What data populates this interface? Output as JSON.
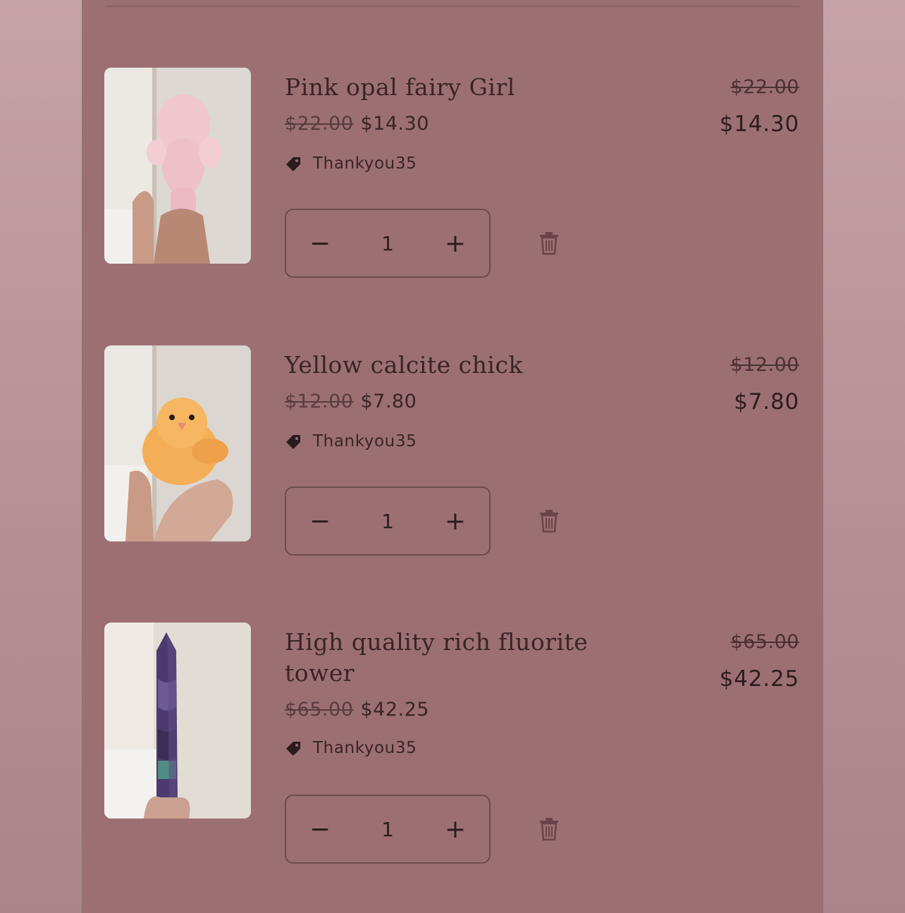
{
  "cart": {
    "items": [
      {
        "title": "Pink opal fairy Girl",
        "compare_price": "$22.00",
        "sale_price": "$14.30",
        "discount_code": "Thankyou35",
        "quantity": "1",
        "line_compare_price": "$22.00",
        "line_total": "$14.30",
        "image": "pink-opal-fairy-figurine"
      },
      {
        "title": "Yellow calcite chick",
        "compare_price": "$12.00",
        "sale_price": "$7.80",
        "discount_code": "Thankyou35",
        "quantity": "1",
        "line_compare_price": "$12.00",
        "line_total": "$7.80",
        "image": "yellow-calcite-chick-figurine"
      },
      {
        "title": "High quality rich fluorite tower",
        "compare_price": "$65.00",
        "sale_price": "$42.25",
        "discount_code": "Thankyou35",
        "quantity": "1",
        "line_compare_price": "$65.00",
        "line_total": "$42.25",
        "image": "fluorite-tower-crystal"
      }
    ],
    "icons": {
      "minus": "−",
      "plus": "+",
      "tag": "tag-icon",
      "remove": "trash-icon"
    }
  },
  "colors": {
    "panel": "#9c7073",
    "text": "#3a2426",
    "border": "#6e4a4e"
  }
}
